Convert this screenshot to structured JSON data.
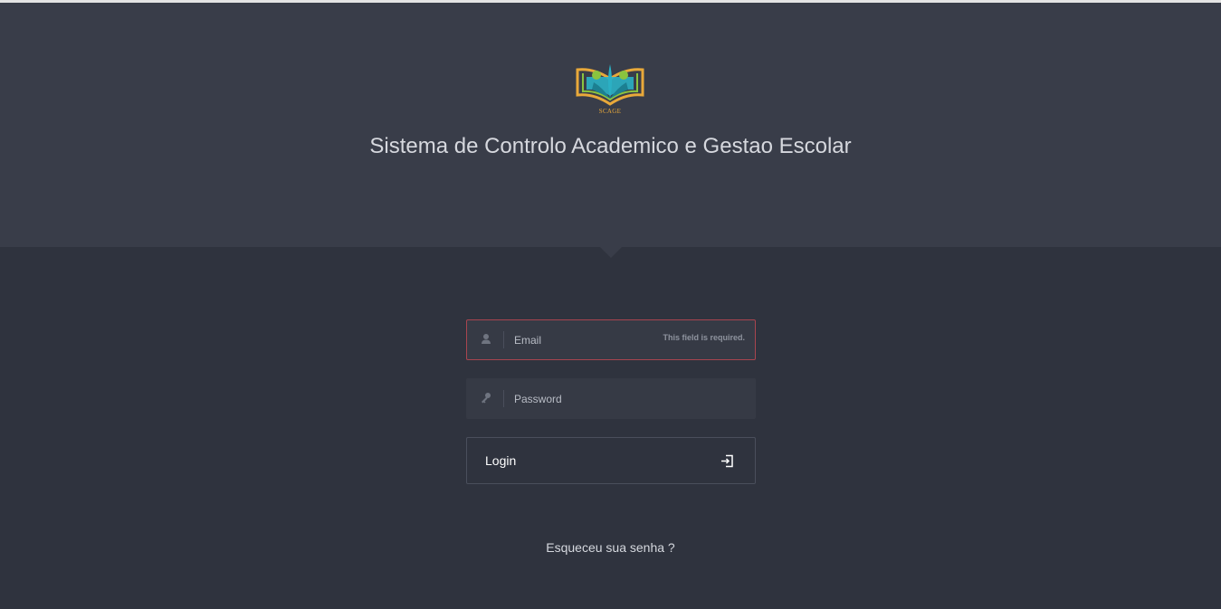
{
  "header": {
    "logo_text": "SCAGE",
    "title": "Sistema de Controlo Academico e Gestao Escolar"
  },
  "form": {
    "email": {
      "placeholder": "Email",
      "value": "",
      "icon": "user-icon",
      "error": "This field is required."
    },
    "password": {
      "placeholder": "Password",
      "value": "",
      "icon": "key-icon"
    },
    "login_button": {
      "label": "Login",
      "icon": "login-icon"
    }
  },
  "forgot_link": "Esqueceu sua senha ?",
  "colors": {
    "header_bg": "#393d49",
    "page_bg": "#2f333e",
    "error_border": "#a8454f",
    "logo_teal": "#2bb0c4",
    "logo_green": "#8ac43f",
    "logo_orange": "#e9a93a"
  }
}
